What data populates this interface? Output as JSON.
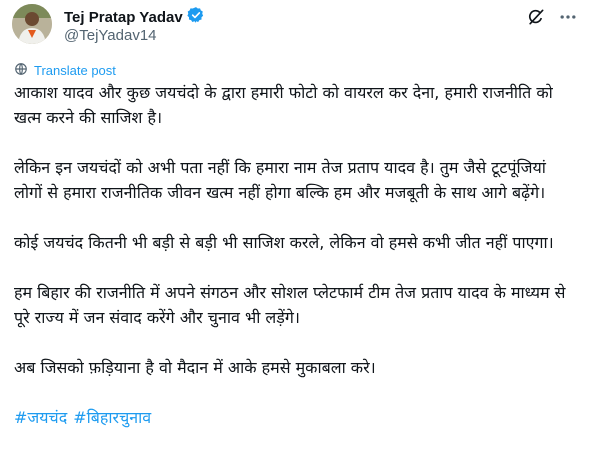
{
  "author": {
    "display_name": "Tej Pratap Yadav",
    "handle": "@TejYadav14",
    "verified": true
  },
  "actions": {
    "grok_icon": "grok-icon",
    "more_icon": "more-icon"
  },
  "translate": {
    "label": "Translate post",
    "icon": "translate-icon"
  },
  "body": {
    "paragraphs": [
      "आकाश यादव और कुछ जयचंदो के द्वारा हमारी फोटो को वायरल कर देना, हमारी राजनीति को खत्म करने की साजिश है।",
      "लेकिन इन जयचंदों को अभी पता नहीं कि हमारा नाम तेज प्रताप यादव है। तुम जैसे टूटपूंजियां लोगों से हमारा राजनीतिक जीवन खत्म नहीं होगा बल्कि हम और मजबूती के साथ आगे बढ़ेंगे।",
      "कोई जयचंद कितनी भी बड़ी से बड़ी भी साजिश करले, लेकिन वो हमसे कभी जीत नहीं पाएगा।",
      "हम बिहार की राजनीति में अपने संगठन और सोशल प्लेटफार्म टीम तेज प्रताप यादव के माध्यम से पूरे राज्य में जन संवाद करेंगे और चुनाव भी लड़ेंगे।",
      "अब जिसको फ़ड़ियाना है वो मैदान में आके हमसे मुकाबला करे।"
    ],
    "hashtags": [
      "#जयचंद",
      "#बिहारचुनाव"
    ]
  },
  "colors": {
    "accent": "#1d9bf0",
    "text": "#0f1419",
    "secondary": "#536471"
  }
}
